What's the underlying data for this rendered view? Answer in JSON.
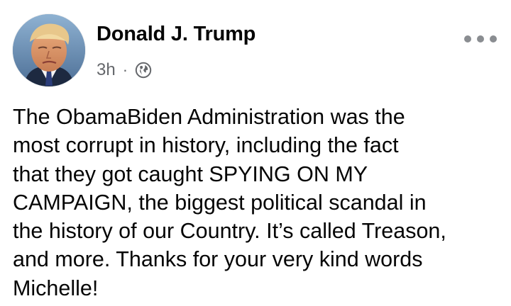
{
  "post": {
    "author": "Donald J. Trump",
    "timestamp": "3h",
    "separator": "·",
    "audience_icon": "globe-icon",
    "more_icon": "more-options-icon",
    "body_lines": [
      "The ObamaBiden Administration was the",
      "most corrupt in history, including the fact",
      "that they got caught SPYING ON MY",
      "CAMPAIGN, the biggest political scandal in",
      "the history of our Country. It’s called Treason,",
      "and more. Thanks for your very kind words",
      "Michelle!"
    ]
  },
  "colors": {
    "text": "#050505",
    "secondary_text": "#65676b",
    "icon_gray": "#8a8d91",
    "background": "#ffffff"
  }
}
